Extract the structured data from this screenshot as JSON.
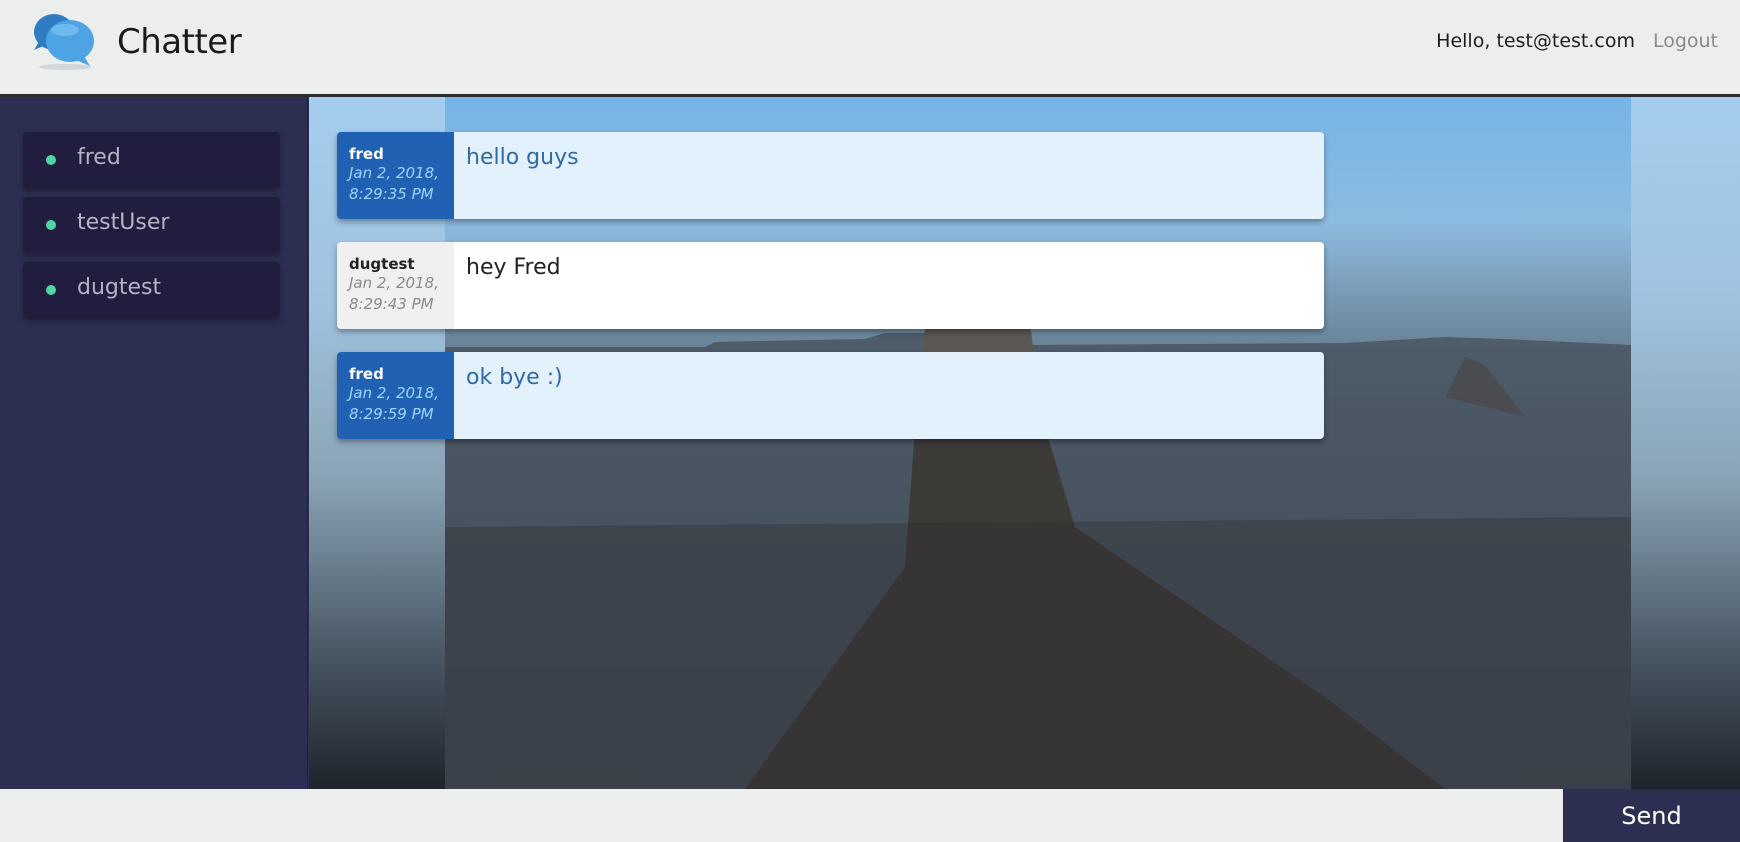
{
  "header": {
    "app_title": "Chatter",
    "greeting": "Hello, test@test.com",
    "logout_label": "Logout",
    "logo_icon": "chat-bubbles-icon"
  },
  "sidebar": {
    "users": [
      {
        "name": "fred",
        "status_color": "#4fd6a2"
      },
      {
        "name": "testUser",
        "status_color": "#4fd6a2"
      },
      {
        "name": "dugtest",
        "status_color": "#4fd6a2"
      }
    ]
  },
  "messages": [
    {
      "user": "fred",
      "date": "Jan 2, 2018,",
      "time": "8:29:35 PM",
      "text": "hello guys",
      "own": true
    },
    {
      "user": "dugtest",
      "date": "Jan 2, 2018,",
      "time": "8:29:43 PM",
      "text": "hey Fred",
      "own": false
    },
    {
      "user": "fred",
      "date": "Jan 2, 2018,",
      "time": "8:29:59 PM",
      "text": "ok bye :)",
      "own": true
    }
  ],
  "composer": {
    "input_value": "",
    "placeholder": "",
    "send_label": "Send"
  },
  "colors": {
    "sidebar_bg": "#2d2f52",
    "user_item_bg": "#201d3f",
    "online_dot": "#4fd6a2",
    "own_meta_bg": "#2061b4",
    "own_body_bg": "#e3f1fc",
    "send_button_bg": "#2d2f52"
  }
}
